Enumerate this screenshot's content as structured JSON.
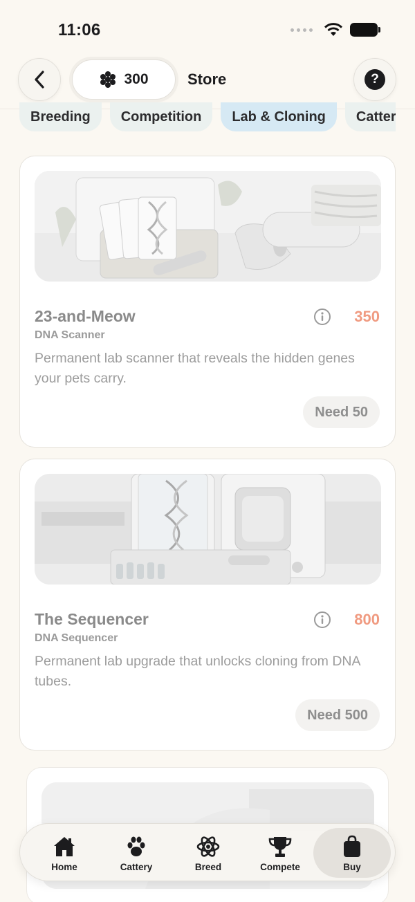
{
  "status_bar": {
    "time": "11:06"
  },
  "header": {
    "currency_amount": "300",
    "title": "Store"
  },
  "tabs": [
    {
      "label": "Breeding",
      "active": false
    },
    {
      "label": "Competition",
      "active": false
    },
    {
      "label": "Lab & Cloning",
      "active": true
    },
    {
      "label": "Cattery",
      "active": false
    }
  ],
  "products": [
    {
      "title": "23-and-Meow",
      "subtitle": "DNA Scanner",
      "description": "Permanent lab scanner that reveals the hidden genes your pets carry.",
      "price": "350",
      "need_label": "Need 50"
    },
    {
      "title": "The Sequencer",
      "subtitle": "DNA Sequencer",
      "description": "Permanent lab upgrade that unlocks cloning from DNA tubes.",
      "price": "800",
      "need_label": "Need 500"
    }
  ],
  "bottom_nav": [
    {
      "label": "Home",
      "icon": "home-icon",
      "active": false
    },
    {
      "label": "Cattery",
      "icon": "paw-icon",
      "active": false
    },
    {
      "label": "Breed",
      "icon": "atom-icon",
      "active": false
    },
    {
      "label": "Compete",
      "icon": "trophy-icon",
      "active": false
    },
    {
      "label": "Buy",
      "icon": "shopping-bag-icon",
      "active": true
    }
  ],
  "colors": {
    "background": "#fbf8f2",
    "price": "#f09a80",
    "active_tab": "#d6e9f4",
    "tab": "#ebf1ef"
  }
}
